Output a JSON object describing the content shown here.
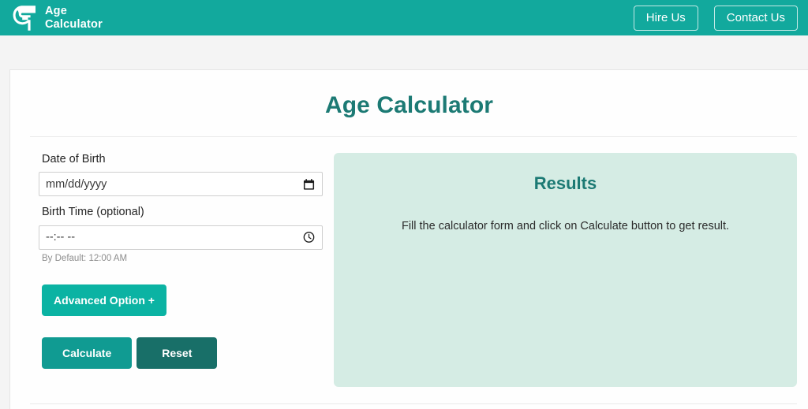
{
  "header": {
    "logo_icon": "age-calculator-logo-icon",
    "brand_name": "Age\nCalculator",
    "hire_label": "Hire Us",
    "contact_label": "Contact Us",
    "background_color": "#12a99d"
  },
  "main": {
    "title": "Age Calculator",
    "accent_color": "#1c7a74"
  },
  "form": {
    "dob_label": "Date of Birth",
    "dob_value": "",
    "dob_placeholder": "mm/dd/yyyy",
    "dob_icon": "calendar-icon",
    "time_label": "Birth Time (optional)",
    "time_value": "",
    "time_placeholder": "--:-- --",
    "time_icon": "clock-icon",
    "helper_text": "By Default: 12:00 AM",
    "advanced_label": "Advanced Option +",
    "calculate_label": "Calculate",
    "reset_label": "Reset",
    "advanced_color": "#0bb3a3",
    "calculate_color": "#109b92",
    "reset_color": "#186f68"
  },
  "results": {
    "title": "Results",
    "empty_message": "Fill the calculator form and click on Calculate button to get result.",
    "panel_color": "#d5ece4"
  }
}
